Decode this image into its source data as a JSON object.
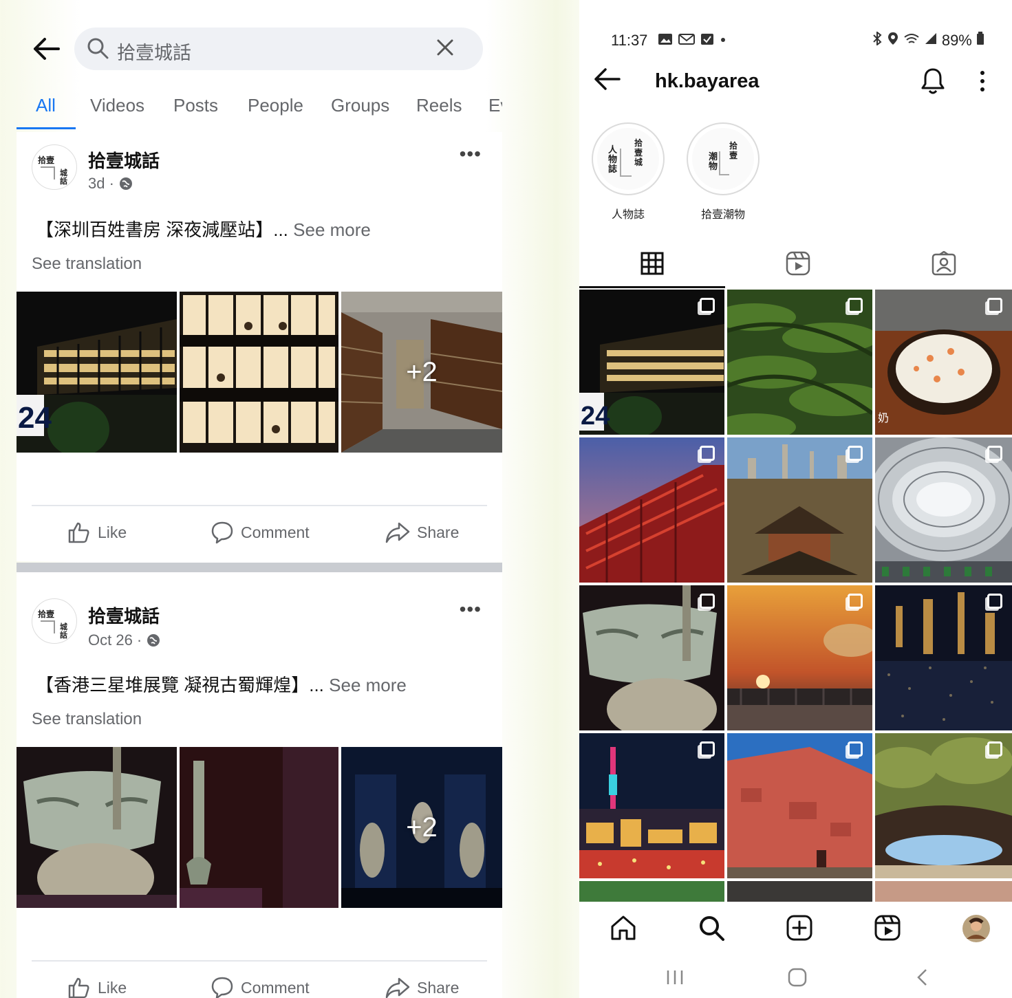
{
  "facebook": {
    "search": {
      "query": "拾壹城話"
    },
    "tabs": [
      {
        "label": "All"
      },
      {
        "label": "Videos"
      },
      {
        "label": "Posts"
      },
      {
        "label": "People"
      },
      {
        "label": "Groups"
      },
      {
        "label": "Reels"
      },
      {
        "label": "Ev"
      }
    ],
    "posts": [
      {
        "author": "拾壹城話",
        "time": "3d ·",
        "text": "【深圳百姓書房  深夜減壓站】...",
        "see_more": "See more",
        "see_translation": "See translation",
        "more_photos": "+2",
        "photo_badge": "24"
      },
      {
        "author": "拾壹城話",
        "time": "Oct 26 ·",
        "text": "【香港三星堆展覽  凝視古蜀輝煌】...",
        "see_more": "See more",
        "see_translation": "See translation",
        "more_photos": "+2"
      }
    ],
    "actions": {
      "like": "Like",
      "comment": "Comment",
      "share": "Share"
    },
    "more_dots": "•••",
    "avatar_text": {
      "a": "拾壹",
      "b": "城",
      "c": "話"
    }
  },
  "instagram": {
    "status": {
      "time": "11:37",
      "battery": "89%"
    },
    "username": "hk.bayarea",
    "highlights": [
      {
        "label": "人物誌",
        "glyphs": [
          "人",
          "物",
          "誌",
          "拾",
          "壹",
          "城"
        ]
      },
      {
        "label": "拾壹潮物",
        "glyphs": [
          "潮",
          "物",
          "拾",
          "壹"
        ]
      }
    ],
    "grid_badge": "24",
    "tile_caption": "奶",
    "colors": {
      "fb_blue": "#1877f2",
      "gray_text": "#65676b"
    }
  }
}
